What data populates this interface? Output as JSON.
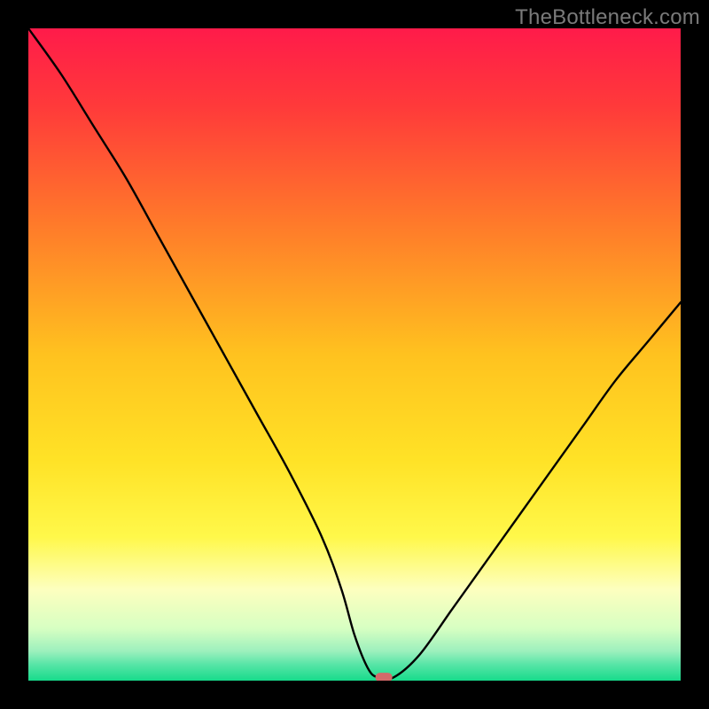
{
  "watermark": "TheBottleneck.com",
  "chart_data": {
    "type": "line",
    "title": "",
    "xlabel": "",
    "ylabel": "",
    "xlim": [
      0,
      100
    ],
    "ylim": [
      0,
      100
    ],
    "grid": false,
    "legend": false,
    "background_gradient_stops": [
      {
        "offset": 0.0,
        "color": "#ff1b4a"
      },
      {
        "offset": 0.12,
        "color": "#ff3a3a"
      },
      {
        "offset": 0.3,
        "color": "#ff7a2a"
      },
      {
        "offset": 0.5,
        "color": "#ffc21f"
      },
      {
        "offset": 0.66,
        "color": "#ffe226"
      },
      {
        "offset": 0.78,
        "color": "#fff84a"
      },
      {
        "offset": 0.86,
        "color": "#fdffbf"
      },
      {
        "offset": 0.92,
        "color": "#d7ffc2"
      },
      {
        "offset": 0.955,
        "color": "#9cf0bd"
      },
      {
        "offset": 0.975,
        "color": "#58e5a7"
      },
      {
        "offset": 1.0,
        "color": "#17db8b"
      }
    ],
    "series": [
      {
        "name": "bottleneck-curve",
        "kind": "line",
        "color": "#000000",
        "width": 2.4,
        "x": [
          0,
          5,
          10,
          15,
          20,
          25,
          30,
          35,
          40,
          45,
          48,
          50,
          52,
          53.5,
          56,
          60,
          65,
          70,
          75,
          80,
          85,
          90,
          95,
          100
        ],
        "values": [
          100,
          93,
          85,
          77,
          68,
          59,
          50,
          41,
          32,
          22,
          14,
          7,
          2,
          0.5,
          0.5,
          4,
          11,
          18,
          25,
          32,
          39,
          46,
          52,
          58
        ]
      }
    ],
    "marker": {
      "name": "optimal-point",
      "x": 54.5,
      "y": 0.5,
      "width_pct": 2.6,
      "height_pct": 1.4,
      "color": "#d46a6a"
    }
  }
}
